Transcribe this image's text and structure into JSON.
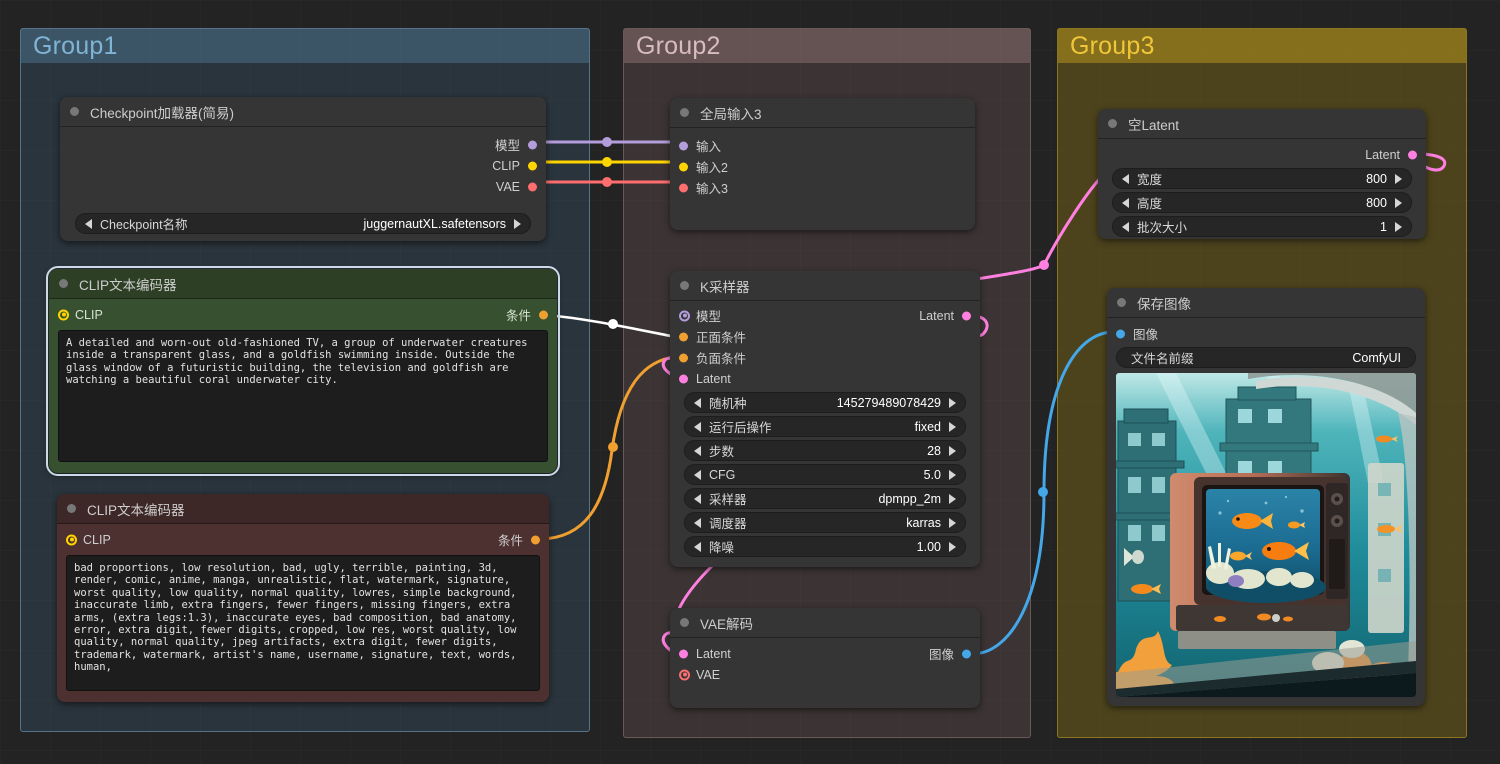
{
  "groups": [
    {
      "id": "group1",
      "title": "Group1"
    },
    {
      "id": "group2",
      "title": "Group2"
    },
    {
      "id": "group3",
      "title": "Group3"
    }
  ],
  "nodes": {
    "checkpoint_loader": {
      "title": "Checkpoint加载器(简易)",
      "outputs": [
        {
          "label": "模型",
          "color": "#b39ddb"
        },
        {
          "label": "CLIP",
          "color": "#ffd500"
        },
        {
          "label": "VAE",
          "color": "#ff6e6e"
        }
      ],
      "widgets": [
        {
          "label": "Checkpoint名称",
          "value": "juggernautXL.safetensors"
        }
      ]
    },
    "clip_positive": {
      "title": "CLIP文本编码器",
      "input": {
        "label": "CLIP",
        "color": "#ffd500"
      },
      "output": {
        "label": "条件",
        "color": "#f0a030"
      },
      "text": "A detailed and worn-out old-fashioned TV, a group of underwater creatures inside a transparent glass, and a goldfish swimming inside. Outside the glass window of a futuristic building, the television and goldfish are watching a beautiful coral underwater city."
    },
    "clip_negative": {
      "title": "CLIP文本编码器",
      "input": {
        "label": "CLIP",
        "color": "#ffd500"
      },
      "output": {
        "label": "条件",
        "color": "#f0a030"
      },
      "text": "bad proportions, low resolution, bad, ugly, terrible, painting, 3d, render, comic, anime, manga, unrealistic, flat, watermark, signature, worst quality, low quality, normal quality, lowres, simple background, inaccurate limb, extra fingers, fewer fingers, missing fingers, extra arms, (extra legs:1.3), inaccurate eyes, bad composition, bad anatomy, error, extra digit, fewer digits, cropped, low res, worst quality, low quality, normal quality, jpeg artifacts, extra digit, fewer digits, trademark, watermark, artist's name, username, signature, text, words, human,"
    },
    "global_input": {
      "title": "全局输入3",
      "inputs": [
        {
          "label": "输入",
          "color": "#b39ddb"
        },
        {
          "label": "输入2",
          "color": "#ffd500"
        },
        {
          "label": "输入3",
          "color": "#ff6e6e"
        }
      ]
    },
    "ksampler": {
      "title": "K采样器",
      "inputs": [
        {
          "label": "模型",
          "color": "#b39ddb",
          "ring": true
        },
        {
          "label": "正面条件",
          "color": "#f0a030"
        },
        {
          "label": "负面条件",
          "color": "#f0a030"
        },
        {
          "label": "Latent",
          "color": "#ff80e0"
        }
      ],
      "outputs": [
        {
          "label": "Latent",
          "color": "#ff80e0"
        }
      ],
      "widgets": [
        {
          "label": "随机种",
          "value": "145279489078429"
        },
        {
          "label": "运行后操作",
          "value": "fixed"
        },
        {
          "label": "步数",
          "value": "28"
        },
        {
          "label": "CFG",
          "value": "5.0"
        },
        {
          "label": "采样器",
          "value": "dpmpp_2m"
        },
        {
          "label": "调度器",
          "value": "karras"
        },
        {
          "label": "降噪",
          "value": "1.00"
        }
      ]
    },
    "vae_decode": {
      "title": "VAE解码",
      "inputs": [
        {
          "label": "Latent",
          "color": "#ff80e0"
        },
        {
          "label": "VAE",
          "color": "#ff6e6e",
          "ring": true
        }
      ],
      "outputs": [
        {
          "label": "图像",
          "color": "#44a7e8"
        }
      ]
    },
    "empty_latent": {
      "title": "空Latent",
      "outputs": [
        {
          "label": "Latent",
          "color": "#ff80e0"
        }
      ],
      "widgets": [
        {
          "label": "宽度",
          "value": "800"
        },
        {
          "label": "高度",
          "value": "800"
        },
        {
          "label": "批次大小",
          "value": "1"
        }
      ]
    },
    "save_image": {
      "title": "保存图像",
      "inputs": [
        {
          "label": "图像",
          "color": "#44a7e8"
        }
      ],
      "widgets": [
        {
          "label": "文件名前缀",
          "value": "ComfyUI"
        }
      ],
      "preview_alt": "underwater city scene with vintage television containing goldfish and coral"
    }
  },
  "link_colors": {
    "model": "#b39ddb",
    "clip": "#ffd500",
    "vae": "#ff6e6e",
    "conditioning_positive": "#ffffff",
    "conditioning_negative": "#f0a030",
    "latent": "#ff80e0",
    "image": "#44a7e8"
  }
}
